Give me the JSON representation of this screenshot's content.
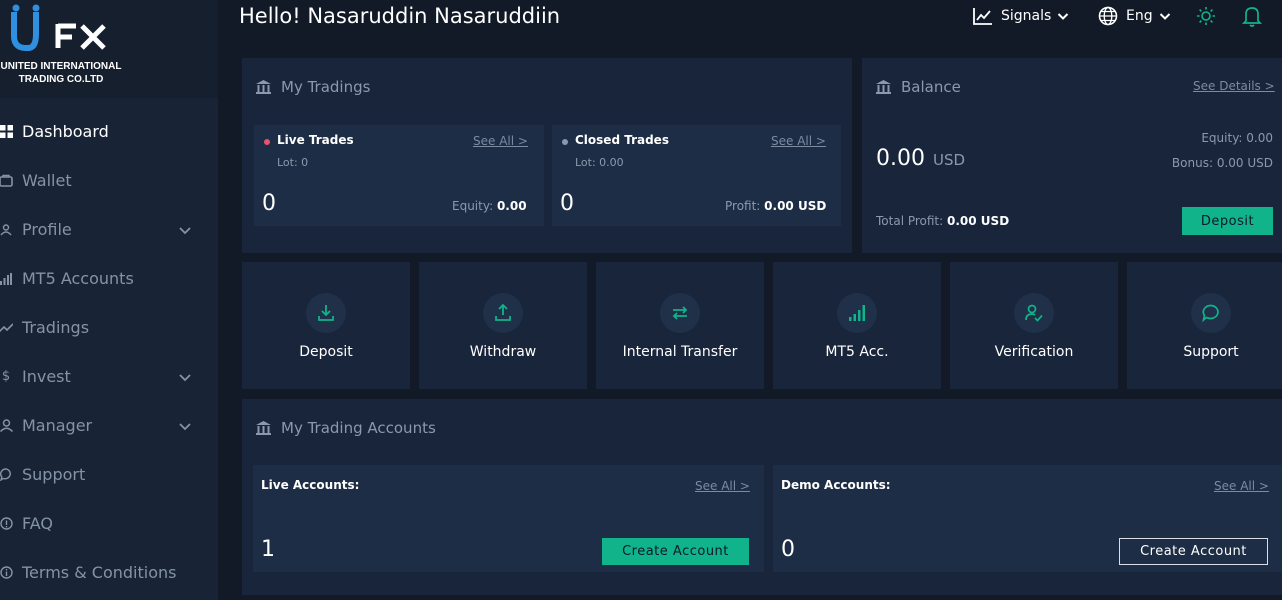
{
  "brand": {
    "logo_text": "UFX",
    "company_line1": "UNITED INTERNATIONAL",
    "company_line2": "TRADING CO.LTD"
  },
  "sidebar": {
    "items": [
      {
        "label": "Dashboard",
        "icon": "dashboard-icon",
        "active": true,
        "has_chevron": false
      },
      {
        "label": "Wallet",
        "icon": "wallet-icon",
        "active": false,
        "has_chevron": false
      },
      {
        "label": "Profile",
        "icon": "user-icon",
        "active": false,
        "has_chevron": true
      },
      {
        "label": "MT5 Accounts",
        "icon": "bar-chart-icon",
        "active": false,
        "has_chevron": false
      },
      {
        "label": "Tradings",
        "icon": "trend-icon",
        "active": false,
        "has_chevron": false
      },
      {
        "label": "Invest",
        "icon": "dollar-icon",
        "active": false,
        "has_chevron": true
      },
      {
        "label": "Manager",
        "icon": "manager-icon",
        "active": false,
        "has_chevron": true
      },
      {
        "label": "Support",
        "icon": "chat-icon",
        "active": false,
        "has_chevron": false
      },
      {
        "label": "FAQ",
        "icon": "help-icon",
        "active": false,
        "has_chevron": false
      },
      {
        "label": "Terms & Conditions",
        "icon": "info-icon",
        "active": false,
        "has_chevron": false
      }
    ]
  },
  "header": {
    "greeting": "Hello! Nasaruddin Nasaruddiin",
    "signals_label": "Signals",
    "language_label": "Eng"
  },
  "my_tradings": {
    "title": "My Tradings",
    "live": {
      "title": "Live Trades",
      "see_all": "See All >",
      "lot": "Lot: 0",
      "count": "0",
      "metric_label": "Equity:",
      "metric_value": "0.00"
    },
    "closed": {
      "title": "Closed Trades",
      "see_all": "See All >",
      "lot": "Lot: 0.00",
      "count": "0",
      "metric_label": "Profit:",
      "metric_value": "0.00 USD"
    }
  },
  "balance": {
    "title": "Balance",
    "see_details": "See Details >",
    "amount": "0.00",
    "currency": "USD",
    "equity": "Equity: 0.00",
    "bonus": "Bonus: 0.00 USD",
    "total_profit_label": "Total Profit:",
    "total_profit_value": "0.00 USD",
    "deposit_button": "Deposit"
  },
  "actions": [
    {
      "label": "Deposit",
      "icon": "download-icon"
    },
    {
      "label": "Withdraw",
      "icon": "upload-icon"
    },
    {
      "label": "Internal Transfer",
      "icon": "transfer-icon"
    },
    {
      "label": "MT5 Acc.",
      "icon": "signal-bars-icon"
    },
    {
      "label": "Verification",
      "icon": "user-check-icon"
    },
    {
      "label": "Support",
      "icon": "chat-bubble-icon"
    }
  ],
  "trading_accounts": {
    "title": "My Trading Accounts",
    "live": {
      "title": "Live Accounts:",
      "see_all": "See All >",
      "count": "1",
      "button": "Create Account"
    },
    "demo": {
      "title": "Demo Accounts:",
      "see_all": "See All >",
      "count": "0",
      "button": "Create Account"
    }
  },
  "colors": {
    "accent": "#10b38a",
    "live_dot": "#e8536e",
    "closed_dot": "#8c99ad",
    "background": "#111a26",
    "card": "#18253a",
    "sidebar": "#182436"
  }
}
